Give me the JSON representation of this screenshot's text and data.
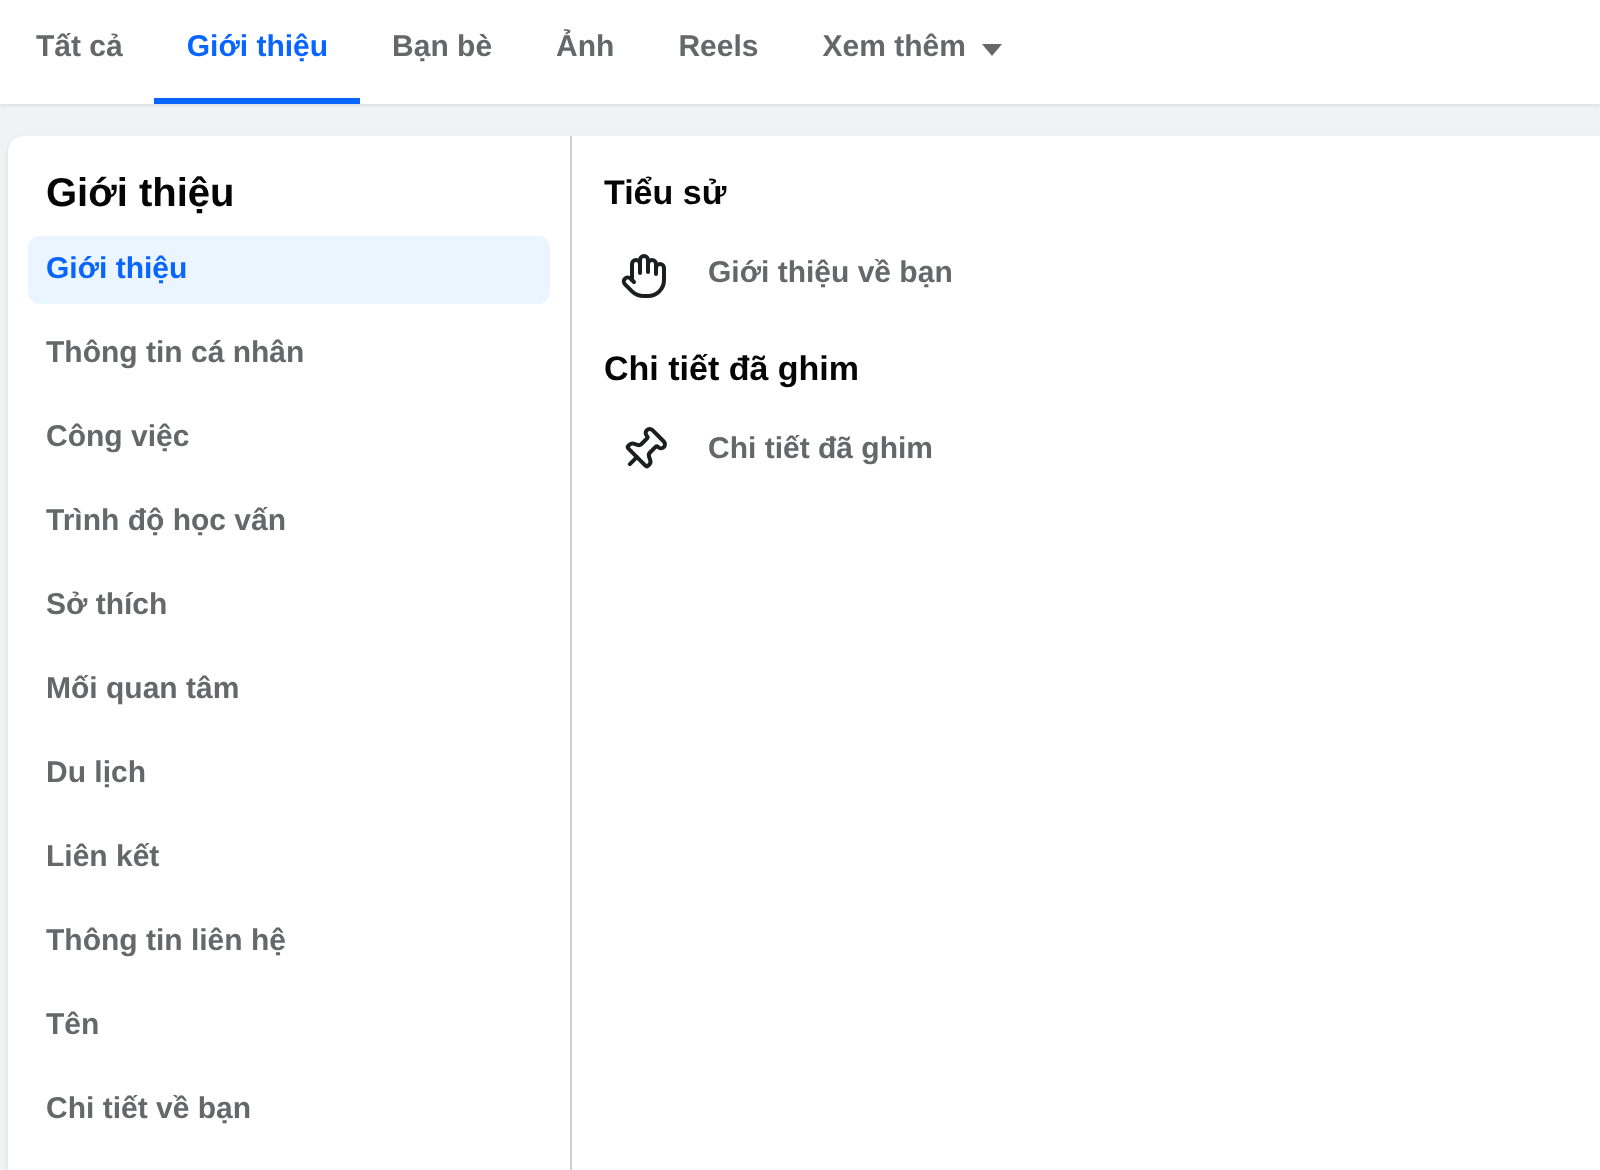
{
  "tabs": [
    {
      "label": "Tất cả",
      "selected": false
    },
    {
      "label": "Giới thiệu",
      "selected": true
    },
    {
      "label": "Bạn bè",
      "selected": false
    },
    {
      "label": "Ảnh",
      "selected": false
    },
    {
      "label": "Reels",
      "selected": false
    },
    {
      "label": "Xem thêm",
      "selected": false,
      "dropdown": true
    }
  ],
  "sidebar": {
    "title": "Giới thiệu",
    "items": [
      {
        "label": "Giới thiệu",
        "selected": true
      },
      {
        "label": "Thông tin cá nhân",
        "selected": false
      },
      {
        "label": "Công việc",
        "selected": false
      },
      {
        "label": "Trình độ học vấn",
        "selected": false
      },
      {
        "label": "Sở thích",
        "selected": false
      },
      {
        "label": "Mối quan tâm",
        "selected": false
      },
      {
        "label": "Du lịch",
        "selected": false
      },
      {
        "label": "Liên kết",
        "selected": false
      },
      {
        "label": "Thông tin liên hệ",
        "selected": false
      },
      {
        "label": "Tên",
        "selected": false
      },
      {
        "label": "Chi tiết về bạn",
        "selected": false
      }
    ]
  },
  "sections": [
    {
      "title": "Tiểu sử",
      "items": [
        {
          "kind": "wave",
          "label": "Giới thiệu về bạn"
        }
      ]
    },
    {
      "title": "Chi tiết đã ghim",
      "items": [
        {
          "kind": "pin",
          "label": "Chi tiết đã ghim"
        }
      ]
    }
  ]
}
